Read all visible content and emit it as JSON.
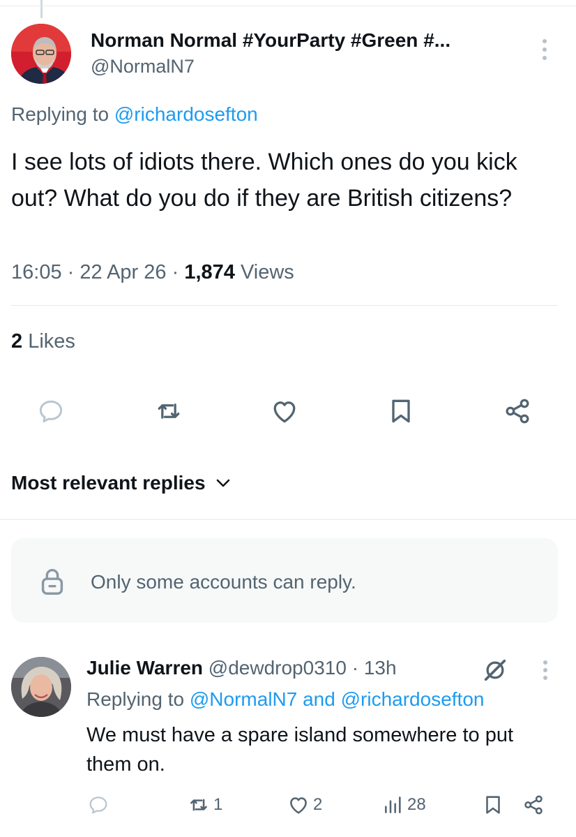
{
  "tweet": {
    "author_name": "Norman Normal #YourParty #Green #...",
    "author_handle": "@NormalN7",
    "replying_prefix": "Replying to",
    "replying_to": "@richardosefton",
    "text": "I see lots of idiots there. Which ones do you kick out? What do you do if they are British citizens?",
    "time": "16:05",
    "date": "22 Apr 26",
    "views_count": "1,874",
    "views_label": "Views",
    "likes_count": "2",
    "likes_label": "Likes"
  },
  "actions": {
    "icons": [
      "reply-icon",
      "retweet-icon",
      "like-icon",
      "bookmark-icon",
      "share-icon"
    ]
  },
  "replies_sort": {
    "label": "Most relevant replies"
  },
  "reply_notice": {
    "text": "Only some accounts can reply."
  },
  "reply": {
    "author_name": "Julie Warren",
    "author_handle": "@dewdrop0310",
    "time_ago": "13h",
    "replying_prefix": "Replying to",
    "replying_to_1": "@NormalN7",
    "replying_and": "and",
    "replying_to_2": "@richardosefton",
    "text": "We must have a spare island somewhere to put them on.",
    "retweets": "1",
    "likes": "2",
    "views": "28"
  },
  "colors": {
    "accent": "#1d9bf0",
    "secondary_text": "#536471",
    "primary_text": "#0f1419"
  }
}
